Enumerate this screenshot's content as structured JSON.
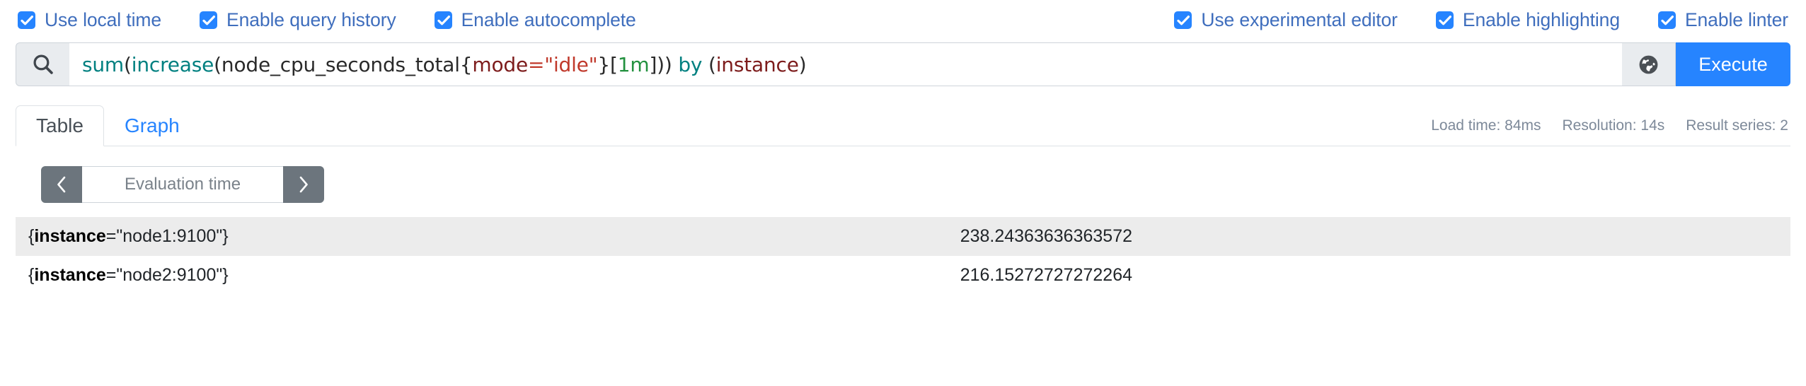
{
  "options": {
    "left": [
      {
        "label": "Use local time",
        "checked": true
      },
      {
        "label": "Enable query history",
        "checked": true
      },
      {
        "label": "Enable autocomplete",
        "checked": true
      }
    ],
    "right": [
      {
        "label": "Use experimental editor",
        "checked": true
      },
      {
        "label": "Enable highlighting",
        "checked": true
      },
      {
        "label": "Enable linter",
        "checked": true
      }
    ]
  },
  "query": {
    "search_icon": "search-icon",
    "globe_icon": "globe-icon",
    "execute_label": "Execute",
    "expression": "sum(increase(node_cpu_seconds_total{mode=\"idle\"}[1m])) by (instance)",
    "tokens": [
      {
        "text": "sum",
        "type": "func"
      },
      {
        "text": "(",
        "type": "plain"
      },
      {
        "text": "increase",
        "type": "func"
      },
      {
        "text": "(",
        "type": "plain"
      },
      {
        "text": "node_cpu_seconds_total{",
        "type": "plain"
      },
      {
        "text": "mode",
        "type": "label"
      },
      {
        "text": "=\"idle\"",
        "type": "string"
      },
      {
        "text": "}[",
        "type": "plain"
      },
      {
        "text": "1m",
        "type": "dur"
      },
      {
        "text": "])) ",
        "type": "plain"
      },
      {
        "text": "by",
        "type": "kw"
      },
      {
        "text": " (",
        "type": "plain"
      },
      {
        "text": "instance",
        "type": "group"
      },
      {
        "text": ")",
        "type": "plain"
      }
    ]
  },
  "tabs": [
    {
      "label": "Table",
      "active": true
    },
    {
      "label": "Graph",
      "active": false
    }
  ],
  "stats": {
    "load_time": "Load time: 84ms",
    "resolution": "Resolution: 14s",
    "result_series": "Result series: 2"
  },
  "evaluation_time": {
    "prev_label": "‹",
    "next_label": "›",
    "value": "",
    "placeholder": "Evaluation time"
  },
  "results": {
    "rows": [
      {
        "metric_open": "{",
        "metric_label": "instance",
        "metric_assign": "=\"node1:9100\"",
        "metric_close": "}",
        "value": "238.24363636363572"
      },
      {
        "metric_open": "{",
        "metric_label": "instance",
        "metric_assign": "=\"node2:9100\"",
        "metric_close": "}",
        "value": "216.15272727272264"
      }
    ]
  },
  "colors": {
    "accent": "#2684ff",
    "checkbox_label": "#3f6ebd",
    "muted": "#7d8999",
    "row_stripe": "#ececec",
    "button_gray": "#6c757d"
  }
}
